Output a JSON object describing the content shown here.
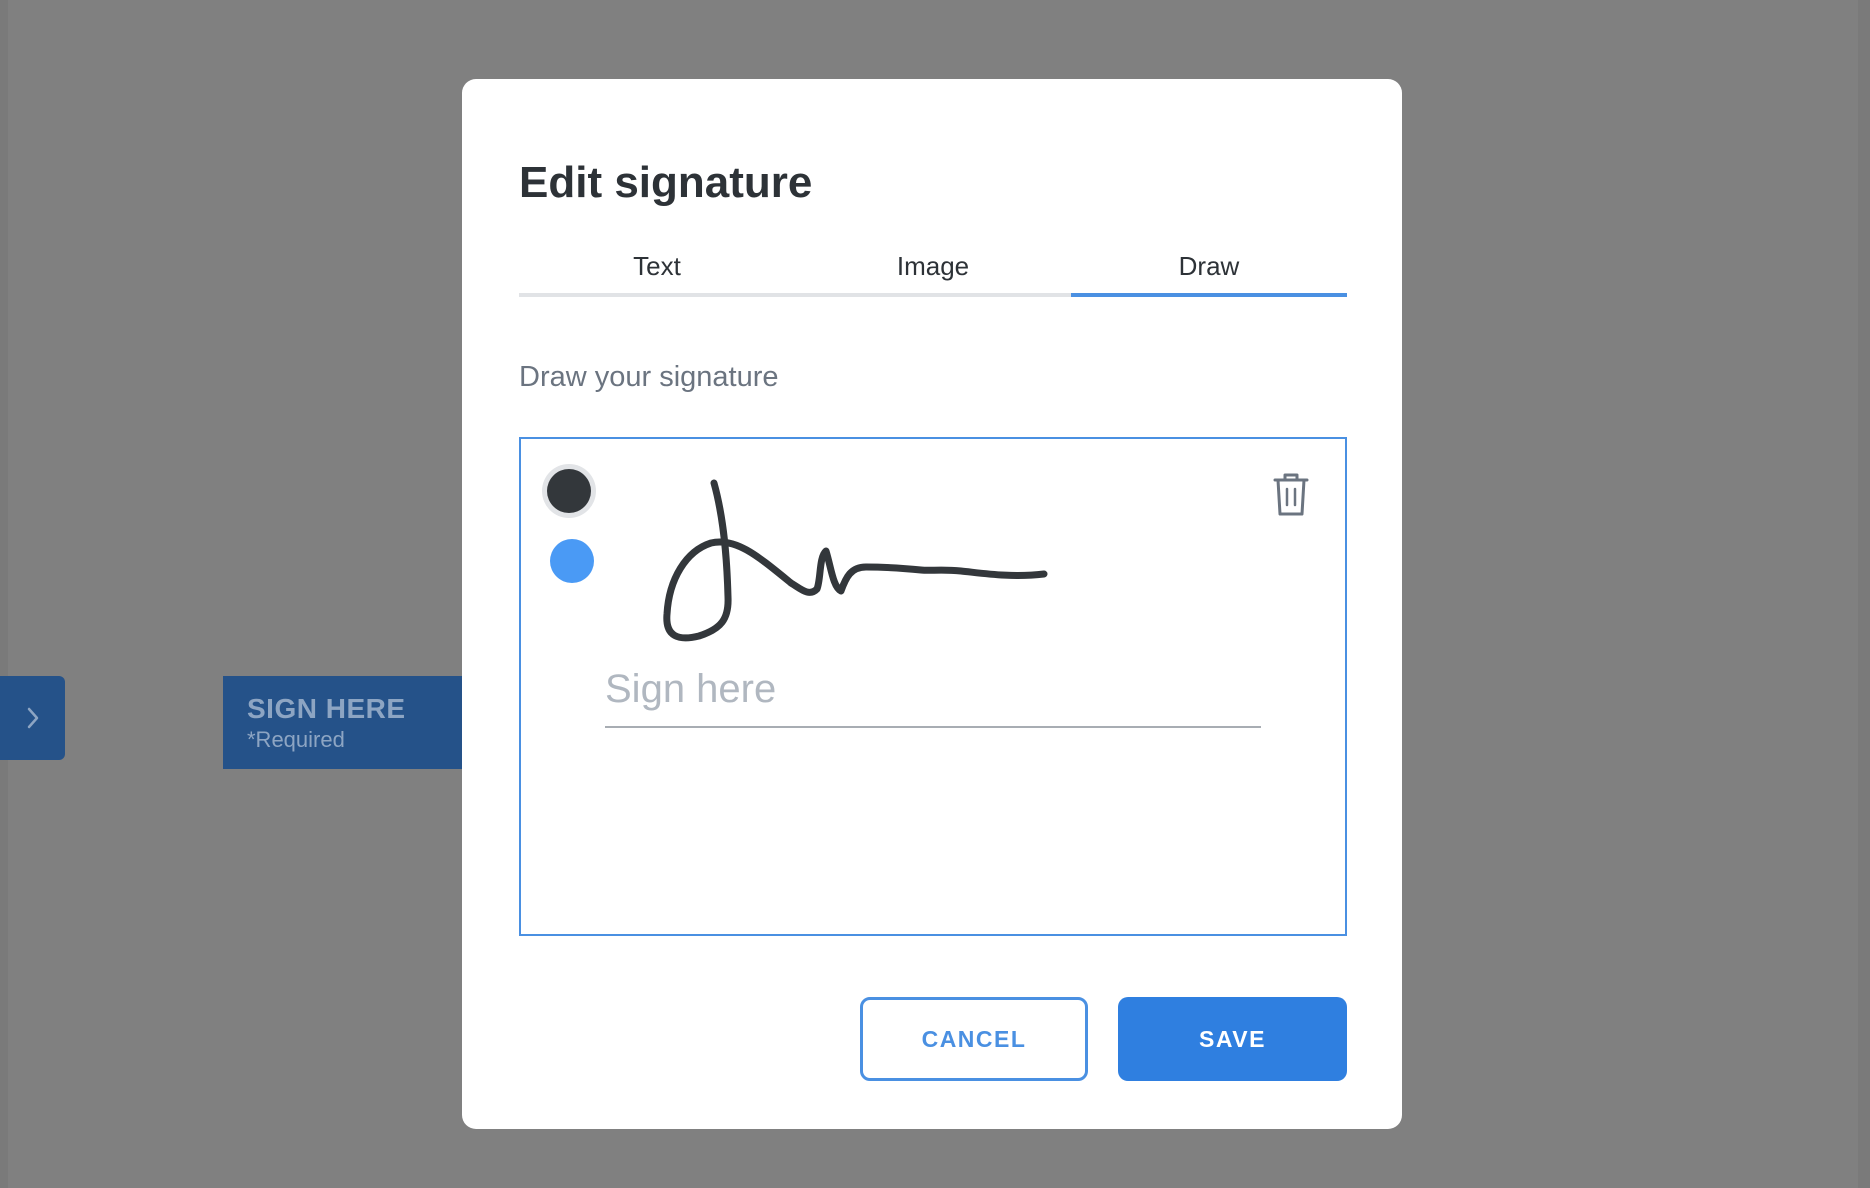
{
  "background": {
    "sign_tag": {
      "title": "SIGN HERE",
      "required": "*Required"
    }
  },
  "modal": {
    "title": "Edit signature",
    "tabs": [
      {
        "label": "Text",
        "active": false
      },
      {
        "label": "Image",
        "active": false
      },
      {
        "label": "Draw",
        "active": true
      }
    ],
    "subtitle": "Draw your signature",
    "pad": {
      "placeholder": "Sign here",
      "colors": [
        "#33373b",
        "#4a9af5"
      ],
      "selected_color": "#33373b"
    },
    "buttons": {
      "cancel": "CANCEL",
      "save": "SAVE"
    }
  },
  "colors": {
    "accent": "#4a90e2",
    "save": "#2f7fe0",
    "overlay": "#808080",
    "tag": "#255289"
  }
}
